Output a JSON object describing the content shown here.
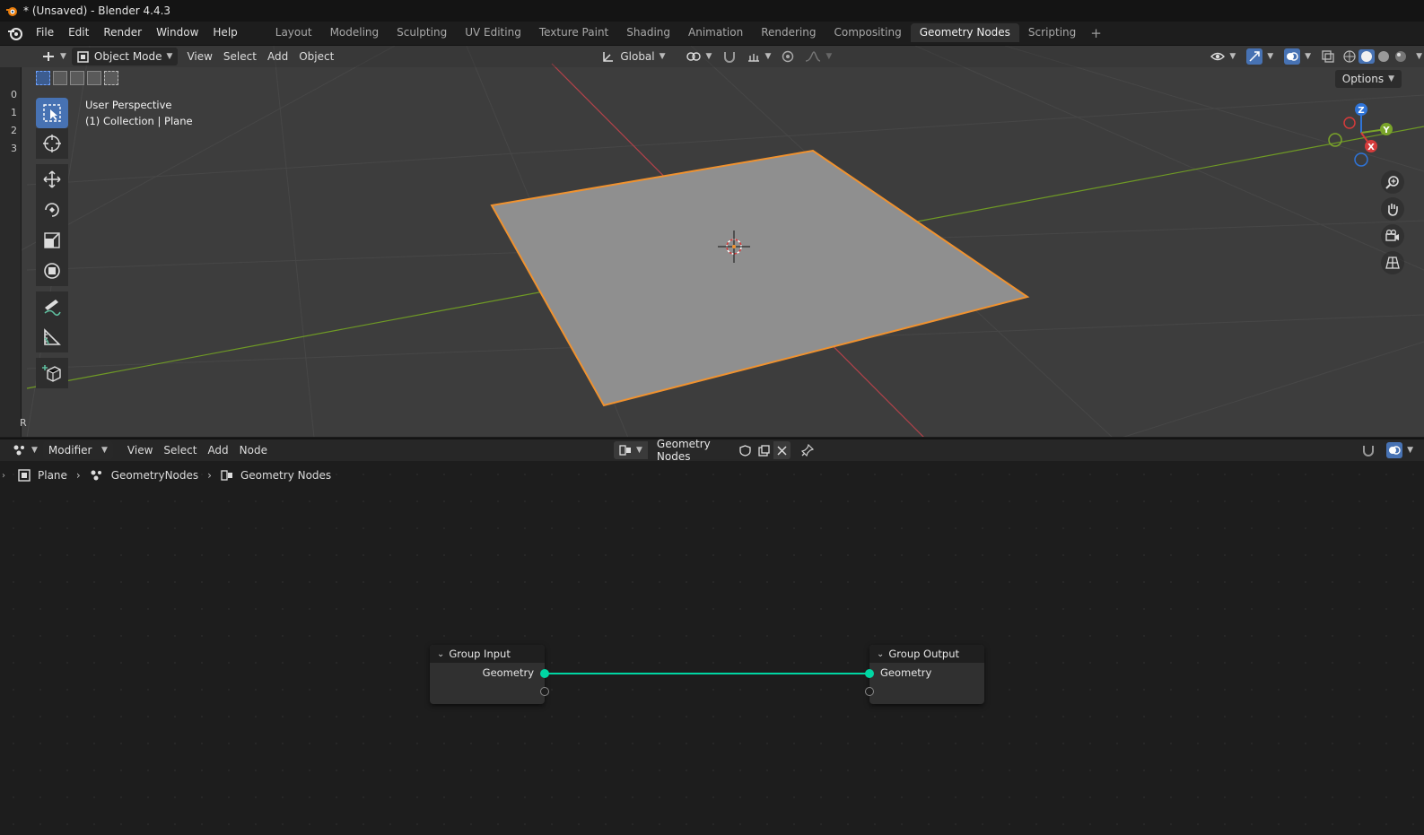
{
  "window": {
    "title": "* (Unsaved) - Blender 4.4.3"
  },
  "topbar": {
    "menus": [
      "File",
      "Edit",
      "Render",
      "Window",
      "Help"
    ],
    "workspaces": [
      "Layout",
      "Modeling",
      "Sculpting",
      "UV Editing",
      "Texture Paint",
      "Shading",
      "Animation",
      "Rendering",
      "Compositing",
      "Geometry Nodes",
      "Scripting"
    ],
    "active_workspace": "Geometry Nodes",
    "add_label": "+"
  },
  "viewport": {
    "mode": "Object Mode",
    "menus": [
      "View",
      "Select",
      "Add",
      "Object"
    ],
    "transform_orientation": "Global",
    "overlay_title": "User Perspective",
    "overlay_subtitle": "(1) Collection | Plane",
    "options_label": "Options",
    "collection_numbers": [
      "0",
      "1",
      "2",
      "3"
    ],
    "left_strip_bottom": "R",
    "gizmo": {
      "x": "X",
      "y": "Y",
      "z": "Z"
    },
    "tools": [
      "select-box",
      "cursor",
      "move",
      "rotate",
      "scale",
      "transform",
      "annotate",
      "measure",
      "add-cube"
    ],
    "active_tool": "select-box",
    "colors": {
      "x_axis": "#b3424a",
      "y_axis": "#7aa42a",
      "selection_outline": "#f0922f",
      "plane_fill": "#8f8f8f"
    }
  },
  "node_editor": {
    "editor_type": "Modifier",
    "menus": [
      "View",
      "Select",
      "Add",
      "Node"
    ],
    "node_group": "Geometry Nodes",
    "breadcrumb": [
      "Plane",
      "GeometryNodes",
      "Geometry Nodes"
    ],
    "nodes": [
      {
        "title": "Group Input",
        "socket": "Geometry"
      },
      {
        "title": "Group Output",
        "socket": "Geometry"
      }
    ],
    "link_color": "#00d6a3"
  }
}
